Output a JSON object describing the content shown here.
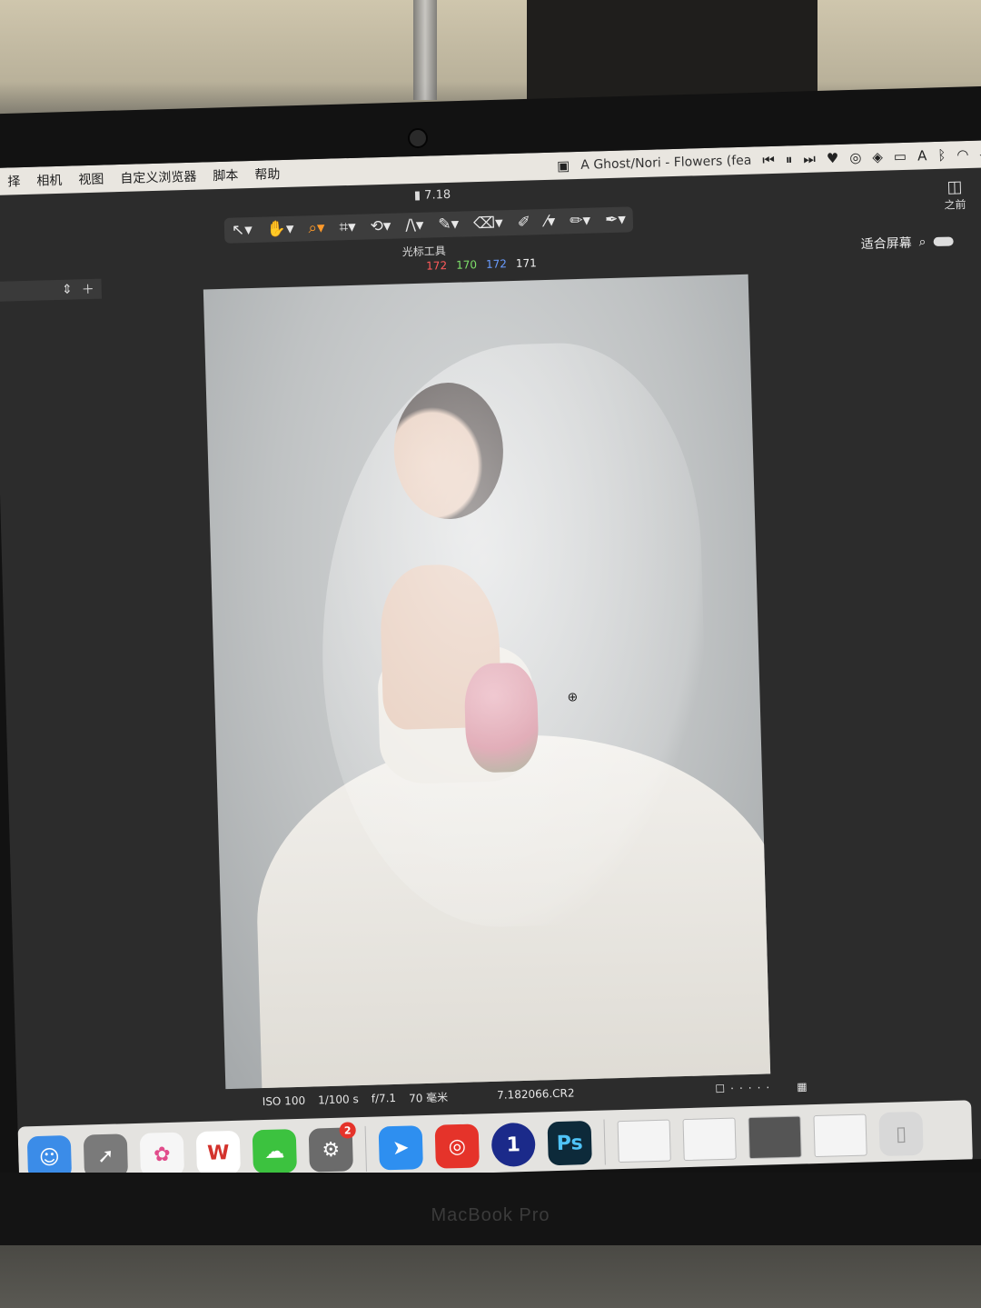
{
  "menubar": {
    "items": [
      "择",
      "相机",
      "视图",
      "自定义浏览器",
      "脚本",
      "帮助"
    ],
    "now_playing": "A Ghost/Nori - Flowers (fea",
    "input_method": "A"
  },
  "window": {
    "title": "7.18"
  },
  "toolbar": {
    "caption": "光标工具"
  },
  "right_panel": {
    "before_label": "之前",
    "fit_screen_label": "适合屏幕"
  },
  "rgb_readout": {
    "r": "172",
    "g": "170",
    "b": "172",
    "a": "171",
    "colors": {
      "r": "#ff5a5a",
      "g": "#7ee06a",
      "b": "#6a9cff",
      "a": "#f0f0f0"
    }
  },
  "status": {
    "iso": "ISO 100",
    "shutter": "1/100 s",
    "aperture": "f/7.1",
    "focal": "70 毫米",
    "filename": "7.182066.CR2"
  },
  "dock": {
    "settings_badge": "2",
    "onepassword_label": "1",
    "ps_label": "Ps"
  },
  "brand": "MacBook Pro"
}
